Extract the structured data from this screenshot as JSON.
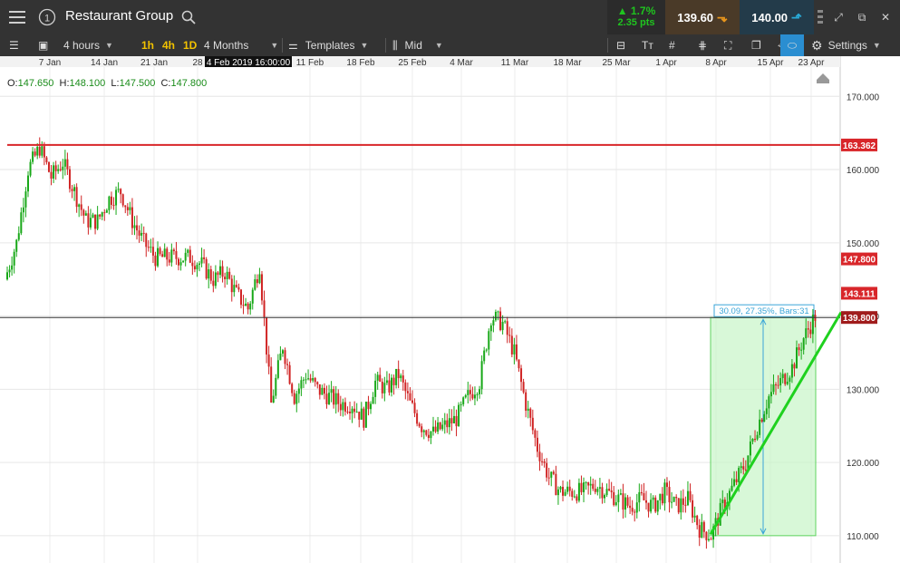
{
  "window": {
    "title": "Restaurant Group",
    "badge_icon": "circle-number-one-icon",
    "change_pct": "1.7%",
    "change_pts": "2.35 pts",
    "sell_price": "139.60",
    "buy_price": "140.00",
    "colors": {
      "up": "#1fc41f",
      "sell_bg": "#4a3a28",
      "buy_bg": "#233b4a",
      "sell_arrow": "#e8951c",
      "buy_arrow": "#29a9d6"
    }
  },
  "toolbar": {
    "interval": "4 hours",
    "quick_intervals": [
      "1h",
      "4h",
      "1D"
    ],
    "range": "4 Months",
    "templates": "Templates",
    "price_type": "Mid",
    "settings": "Settings"
  },
  "axis": {
    "x_labels": [
      "7 Jan",
      "14 Jan",
      "21 Jan",
      "28",
      "11 Feb",
      "18 Feb",
      "25 Feb",
      "4 Mar",
      "11 Mar",
      "18 Mar",
      "25 Mar",
      "1 Apr",
      "8 Apr",
      "15 Apr",
      "23 Apr"
    ],
    "crosshair_label": "4 Feb 2019 16:00:00",
    "y_labels": [
      "170.000",
      "160.000",
      "150.000",
      "140.000",
      "130.000",
      "120.000",
      "110.000"
    ]
  },
  "ohlc": {
    "o_label": "O:",
    "o": "147.650",
    "h_label": "H:",
    "h": "148.100",
    "l_label": "L:",
    "l": "147.500",
    "c_label": "C:",
    "c": "147.800"
  },
  "price_tags": [
    {
      "value": "163.362",
      "color": "#d8262a"
    },
    {
      "value": "147.800",
      "color": "#d8262a"
    },
    {
      "value": "143.111",
      "color": "#d8262a"
    },
    {
      "value": "139.800",
      "color": "#a01c1c"
    }
  ],
  "measure": {
    "label": "30.09, 27.35%, Bars:31"
  },
  "chart_data": {
    "type": "candlestick",
    "title": "Restaurant Group",
    "ylim": [
      108,
      174
    ],
    "horizontal_lines": [
      163.362,
      139.8
    ],
    "trend_line": {
      "from": 110.2,
      "to": 140.5
    },
    "measure_box": {
      "low": 110,
      "high": 139.8
    },
    "path": [
      145,
      150,
      160,
      163,
      159,
      161,
      157,
      153,
      153,
      156,
      157,
      153,
      150,
      148,
      148,
      148,
      148,
      147,
      145,
      146,
      143,
      141,
      147,
      128,
      136,
      129,
      132,
      130,
      129,
      128,
      128,
      126,
      131,
      130,
      132,
      128,
      125,
      124,
      125,
      126,
      129,
      131,
      140,
      139,
      135,
      128,
      122,
      118,
      116,
      116,
      116,
      117,
      116,
      115,
      114,
      115,
      114,
      116,
      114,
      115,
      111,
      110,
      114,
      117,
      120,
      125,
      129,
      131,
      133,
      137,
      140
    ]
  }
}
